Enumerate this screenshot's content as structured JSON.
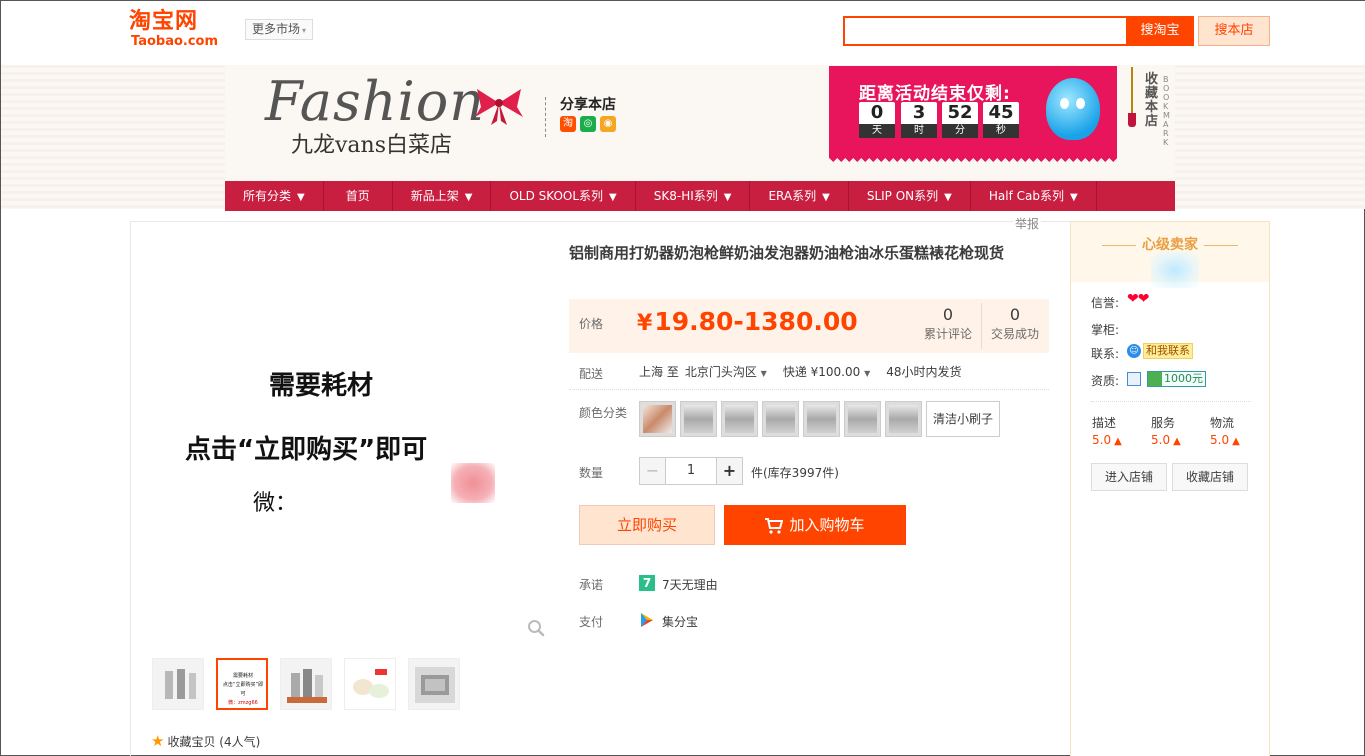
{
  "header": {
    "logo_cn": "淘宝网",
    "logo_en": "Taobao.com",
    "more_market": "更多市场",
    "search_button": "搜淘宝",
    "search_store_button": "搜本店",
    "search_value": ""
  },
  "shop": {
    "logo_script": "Fashion",
    "name": "九龙vans白菜店",
    "share_title": "分享本店",
    "share_icons": [
      "taobao-share-icon",
      "wangwang-share-icon",
      "weibo-share-icon"
    ],
    "countdown_title": "距离活动结束仅剩:",
    "countdown": [
      {
        "value": "0",
        "unit": "天"
      },
      {
        "value": "3",
        "unit": "时"
      },
      {
        "value": "52",
        "unit": "分"
      },
      {
        "value": "45",
        "unit": "秒"
      }
    ],
    "bookmark_cn": "收藏本店",
    "bookmark_en": "BOOKMARK"
  },
  "nav": [
    {
      "label": "所有分类",
      "dropdown": true
    },
    {
      "label": "首页",
      "dropdown": false
    },
    {
      "label": "新品上架",
      "dropdown": true
    },
    {
      "label": "OLD SKOOL系列",
      "dropdown": true
    },
    {
      "label": "SK8-HI系列",
      "dropdown": true
    },
    {
      "label": "ERA系列",
      "dropdown": true
    },
    {
      "label": "SLIP ON系列",
      "dropdown": true
    },
    {
      "label": "Half Cab系列",
      "dropdown": true
    }
  ],
  "report": "举报",
  "main_image": {
    "line1": "需要耗材",
    "line2": "点击“立即购买”即可",
    "line3": "微："
  },
  "thumbnails_count": 5,
  "thumb_text": {
    "t1": "需要耗材",
    "t2": "点击“立即购买”即可",
    "t3": "微：zmzg66"
  },
  "favorite": {
    "label": "收藏宝贝",
    "count": "(4人气)"
  },
  "product": {
    "title": "铝制商用打奶器奶泡枪鲜奶油发泡器奶油枪油冰乐蛋糕裱花枪现货",
    "price_label": "价格",
    "currency": "¥",
    "price": "19.80-1380.00",
    "reviews_count": "0",
    "reviews_label": "累计评论",
    "sales_count": "0",
    "sales_label": "交易成功",
    "shipping_label": "配送",
    "ship_from": "上海 至",
    "ship_to": "北京门头沟区",
    "ship_method": "快递 ¥100.00",
    "ship_time": "48小时内发货",
    "color_label": "颜色分类",
    "color_text_option": "清洁小刷子",
    "swatch_count": 7,
    "quantity_label": "数量",
    "quantity": "1",
    "stock": "件(库存3997件)",
    "buy_now": "立即购买",
    "add_to_cart": "加入购物车",
    "promise_label": "承诺",
    "promise_icon_glyph": "7",
    "promise_text": "7天无理由",
    "pay_label": "支付",
    "pay_text": "集分宝"
  },
  "seller": {
    "title": "心级卖家",
    "credit_label": "信誉:",
    "credit_hearts": "❤❤",
    "keeper_label": "掌柜:",
    "contact_label": "联系:",
    "contact_tag": "和我联系",
    "qualification_label": "资质:",
    "bond": "1000元",
    "scores": [
      {
        "label": "描述",
        "value": "5.0"
      },
      {
        "label": "服务",
        "value": "5.0"
      },
      {
        "label": "物流",
        "value": "5.0"
      }
    ],
    "enter_shop": "进入店铺",
    "favorite_shop": "收藏店铺"
  },
  "colors": {
    "accent": "#ff4400",
    "nav": "#c81e40",
    "countdown": "#e8145c"
  }
}
